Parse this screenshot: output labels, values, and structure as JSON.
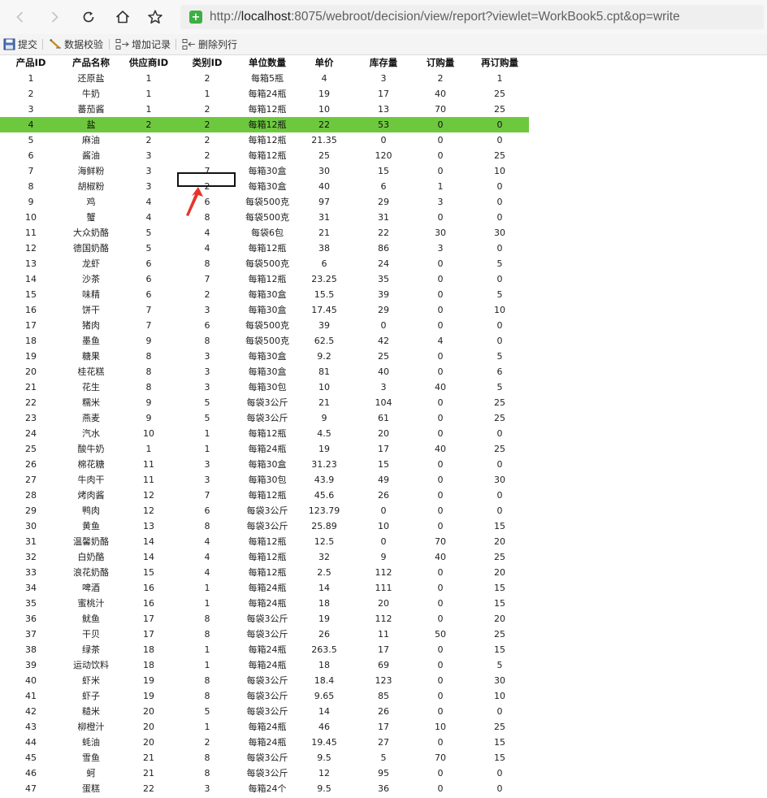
{
  "browser": {
    "url_scheme": "http://",
    "url_host": "localhost",
    "url_rest": ":8075/webroot/decision/view/report?viewlet=WorkBook5.cpt&op=write"
  },
  "toolbar": {
    "submit_label": "提交",
    "validate_label": "数据校验",
    "add_row_label": "增加记录",
    "delete_row_label": "删除列行"
  },
  "table": {
    "headers": [
      "产品ID",
      "产品名称",
      "供应商ID",
      "类别ID",
      "单位数量",
      "单价",
      "库存量",
      "订购量",
      "再订购量"
    ],
    "selected_row_index": 3,
    "rows": [
      [
        "1",
        "还原盐",
        "1",
        "2",
        "每箱5瓶",
        "4",
        "3",
        "2",
        "1"
      ],
      [
        "2",
        "牛奶",
        "1",
        "1",
        "每箱24瓶",
        "19",
        "17",
        "40",
        "25"
      ],
      [
        "3",
        "蕃茄酱",
        "1",
        "2",
        "每箱12瓶",
        "10",
        "13",
        "70",
        "25"
      ],
      [
        "4",
        "盐",
        "2",
        "2",
        "每箱12瓶",
        "22",
        "53",
        "0",
        "0"
      ],
      [
        "5",
        "麻油",
        "2",
        "2",
        "每箱12瓶",
        "21.35",
        "0",
        "0",
        "0"
      ],
      [
        "6",
        "酱油",
        "3",
        "2",
        "每箱12瓶",
        "25",
        "120",
        "0",
        "25"
      ],
      [
        "7",
        "海鲜粉",
        "3",
        "7",
        "每箱30盒",
        "30",
        "15",
        "0",
        "10"
      ],
      [
        "8",
        "胡椒粉",
        "3",
        "2",
        "每箱30盒",
        "40",
        "6",
        "1",
        "0"
      ],
      [
        "9",
        "鸡",
        "4",
        "6",
        "每袋500克",
        "97",
        "29",
        "3",
        "0"
      ],
      [
        "10",
        "蟹",
        "4",
        "8",
        "每袋500克",
        "31",
        "31",
        "0",
        "0"
      ],
      [
        "11",
        "大众奶酪",
        "5",
        "4",
        "每袋6包",
        "21",
        "22",
        "30",
        "30"
      ],
      [
        "12",
        "德国奶酪",
        "5",
        "4",
        "每箱12瓶",
        "38",
        "86",
        "3",
        "0"
      ],
      [
        "13",
        "龙虾",
        "6",
        "8",
        "每袋500克",
        "6",
        "24",
        "0",
        "5"
      ],
      [
        "14",
        "沙茶",
        "6",
        "7",
        "每箱12瓶",
        "23.25",
        "35",
        "0",
        "0"
      ],
      [
        "15",
        "味精",
        "6",
        "2",
        "每箱30盒",
        "15.5",
        "39",
        "0",
        "5"
      ],
      [
        "16",
        "饼干",
        "7",
        "3",
        "每箱30盒",
        "17.45",
        "29",
        "0",
        "10"
      ],
      [
        "17",
        "猪肉",
        "7",
        "6",
        "每袋500克",
        "39",
        "0",
        "0",
        "0"
      ],
      [
        "18",
        "墨鱼",
        "9",
        "8",
        "每袋500克",
        "62.5",
        "42",
        "4",
        "0"
      ],
      [
        "19",
        "糖果",
        "8",
        "3",
        "每箱30盒",
        "9.2",
        "25",
        "0",
        "5"
      ],
      [
        "20",
        "桂花糕",
        "8",
        "3",
        "每箱30盒",
        "81",
        "40",
        "0",
        "6"
      ],
      [
        "21",
        "花生",
        "8",
        "3",
        "每箱30包",
        "10",
        "3",
        "40",
        "5"
      ],
      [
        "22",
        "糯米",
        "9",
        "5",
        "每袋3公斤",
        "21",
        "104",
        "0",
        "25"
      ],
      [
        "23",
        "燕麦",
        "9",
        "5",
        "每袋3公斤",
        "9",
        "61",
        "0",
        "25"
      ],
      [
        "24",
        "汽水",
        "10",
        "1",
        "每箱12瓶",
        "4.5",
        "20",
        "0",
        "0"
      ],
      [
        "25",
        "酸牛奶",
        "1",
        "1",
        "每箱24瓶",
        "19",
        "17",
        "40",
        "25"
      ],
      [
        "26",
        "棉花糖",
        "11",
        "3",
        "每箱30盒",
        "31.23",
        "15",
        "0",
        "0"
      ],
      [
        "27",
        "牛肉干",
        "11",
        "3",
        "每箱30包",
        "43.9",
        "49",
        "0",
        "30"
      ],
      [
        "28",
        "烤肉酱",
        "12",
        "7",
        "每箱12瓶",
        "45.6",
        "26",
        "0",
        "0"
      ],
      [
        "29",
        "鸭肉",
        "12",
        "6",
        "每袋3公斤",
        "123.79",
        "0",
        "0",
        "0"
      ],
      [
        "30",
        "黄鱼",
        "13",
        "8",
        "每袋3公斤",
        "25.89",
        "10",
        "0",
        "15"
      ],
      [
        "31",
        "温馨奶酪",
        "14",
        "4",
        "每箱12瓶",
        "12.5",
        "0",
        "70",
        "20"
      ],
      [
        "32",
        "白奶酪",
        "14",
        "4",
        "每箱12瓶",
        "32",
        "9",
        "40",
        "25"
      ],
      [
        "33",
        "浪花奶酪",
        "15",
        "4",
        "每箱12瓶",
        "2.5",
        "112",
        "0",
        "20"
      ],
      [
        "34",
        "啤酒",
        "16",
        "1",
        "每箱24瓶",
        "14",
        "111",
        "0",
        "15"
      ],
      [
        "35",
        "蜜桃汁",
        "16",
        "1",
        "每箱24瓶",
        "18",
        "20",
        "0",
        "15"
      ],
      [
        "36",
        "鱿鱼",
        "17",
        "8",
        "每袋3公斤",
        "19",
        "112",
        "0",
        "20"
      ],
      [
        "37",
        "干贝",
        "17",
        "8",
        "每袋3公斤",
        "26",
        "11",
        "50",
        "25"
      ],
      [
        "38",
        "绿茶",
        "18",
        "1",
        "每箱24瓶",
        "263.5",
        "17",
        "0",
        "15"
      ],
      [
        "39",
        "运动饮料",
        "18",
        "1",
        "每箱24瓶",
        "18",
        "69",
        "0",
        "5"
      ],
      [
        "40",
        "虾米",
        "19",
        "8",
        "每袋3公斤",
        "18.4",
        "123",
        "0",
        "30"
      ],
      [
        "41",
        "虾子",
        "19",
        "8",
        "每袋3公斤",
        "9.65",
        "85",
        "0",
        "10"
      ],
      [
        "42",
        "糙米",
        "20",
        "5",
        "每袋3公斤",
        "14",
        "26",
        "0",
        "0"
      ],
      [
        "43",
        "柳橙汁",
        "20",
        "1",
        "每箱24瓶",
        "46",
        "17",
        "10",
        "25"
      ],
      [
        "44",
        "蚝油",
        "20",
        "2",
        "每箱24瓶",
        "19.45",
        "27",
        "0",
        "15"
      ],
      [
        "45",
        "雪鱼",
        "21",
        "8",
        "每袋3公斤",
        "9.5",
        "5",
        "70",
        "15"
      ],
      [
        "46",
        "蚵",
        "21",
        "8",
        "每袋3公斤",
        "12",
        "95",
        "0",
        "0"
      ],
      [
        "47",
        "蛋糕",
        "22",
        "3",
        "每箱24个",
        "9.5",
        "36",
        "0",
        "0"
      ]
    ]
  }
}
